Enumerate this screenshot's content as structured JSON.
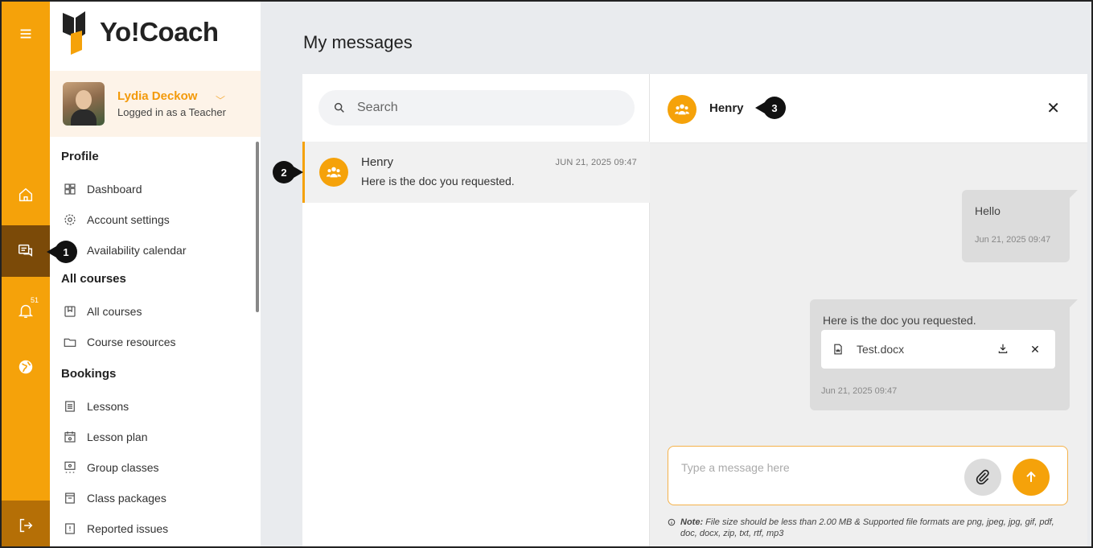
{
  "rail": {
    "badge": "51"
  },
  "brand": {
    "name": "Yo!Coach"
  },
  "user": {
    "name": "Lydia Deckow",
    "role": "Logged in as a Teacher"
  },
  "menu": {
    "profile_head": "Profile",
    "profile_items": [
      "Dashboard",
      "Account settings",
      "Availability calendar"
    ],
    "courses_head": "All courses",
    "courses_items": [
      "All courses",
      "Course resources"
    ],
    "bookings_head": "Bookings",
    "bookings_items": [
      "Lessons",
      "Lesson plan",
      "Group classes",
      "Class packages",
      "Reported issues"
    ]
  },
  "page": {
    "title": "My messages"
  },
  "search": {
    "placeholder": "Search"
  },
  "thread": {
    "name": "Henry",
    "date": "JUN 21, 2025 09:47",
    "preview": "Here is the doc you requested."
  },
  "chat": {
    "name": "Henry",
    "close": "✕",
    "messages": [
      {
        "text": "Hello",
        "date": "Jun 21, 2025 09:47"
      },
      {
        "text": "Here is the doc you requested.",
        "file": "Test.docx",
        "date": "Jun 21, 2025 09:47"
      }
    ]
  },
  "composer": {
    "placeholder": "Type a message here",
    "note_label": "Note:",
    "note_text": "File size should be less than 2.00 MB & Supported file formats are png, jpeg, jpg, gif, pdf, doc, docx, zip, txt, rtf, mp3"
  },
  "callouts": [
    "1",
    "2",
    "3"
  ],
  "colors": {
    "accent": "#f5a20a",
    "rail_active": "#7b4a08"
  }
}
